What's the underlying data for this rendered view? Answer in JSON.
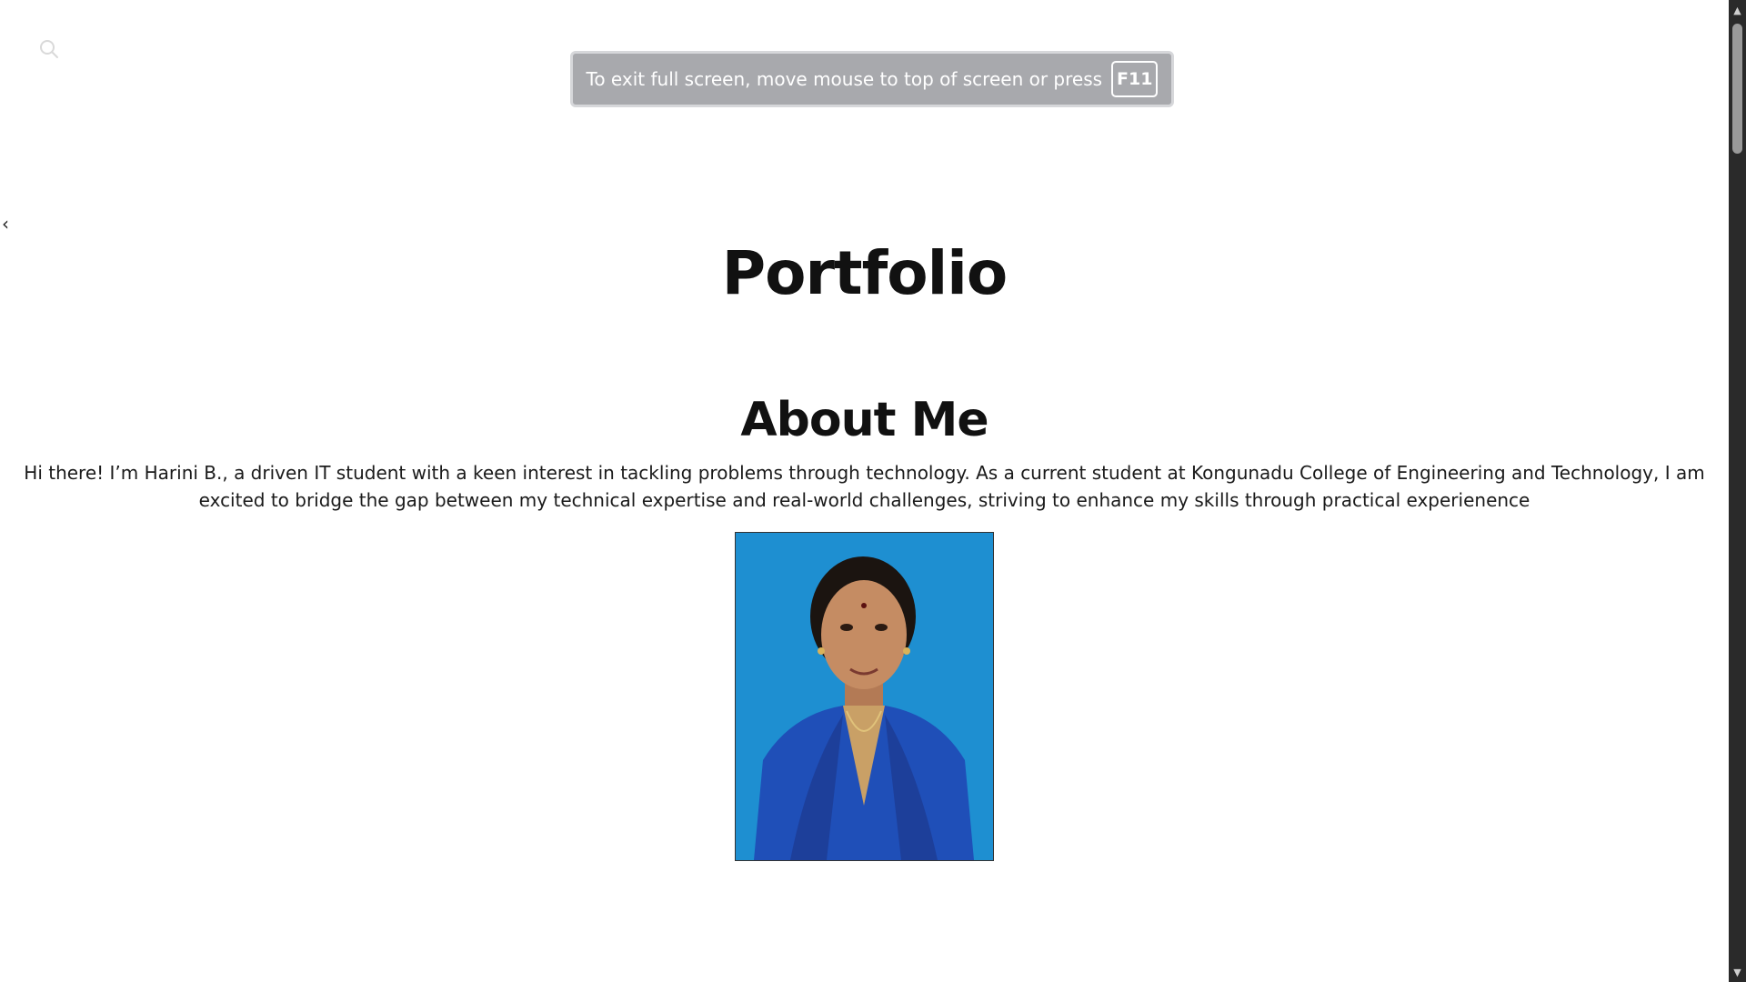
{
  "search": {
    "icon": "search-icon"
  },
  "fullscreen_banner": {
    "message": "To exit full screen, move mouse to top of screen or press",
    "key": "F11"
  },
  "nav": {
    "back_label": "‹"
  },
  "site": {
    "title": "Portfolio"
  },
  "about": {
    "heading": "About Me",
    "text": "Hi there! I’m Harini B., a driven IT student with a keen interest in tackling problems through technology. As a current student at Kongunadu College of Engineering and Technology, I am excited to bridge the gap between my technical expertise and real-world challenges, striving to enhance my skills through practical experienence"
  },
  "scrollbar": {
    "up_icon": "▲",
    "down_icon": "▼",
    "position_fraction": 0.0
  },
  "colors": {
    "photo_background": "#1e8fd1",
    "banner_background": "#a8a9ad"
  }
}
